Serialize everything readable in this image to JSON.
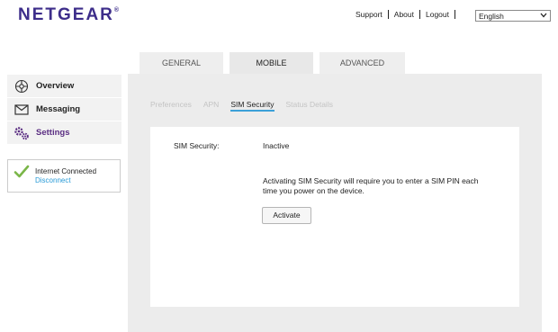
{
  "brand": {
    "name": "NETGEAR",
    "mark": "®"
  },
  "header": {
    "links": [
      "Support",
      "About",
      "Logout"
    ],
    "language": "English"
  },
  "tabs": [
    {
      "label": "GENERAL",
      "active": false
    },
    {
      "label": "MOBILE",
      "active": true
    },
    {
      "label": "ADVANCED",
      "active": false
    }
  ],
  "subtabs": [
    {
      "label": "Preferences",
      "active": false
    },
    {
      "label": "APN",
      "active": false
    },
    {
      "label": "SIM Security",
      "active": true
    },
    {
      "label": "Status Details",
      "active": false
    }
  ],
  "sidebar": {
    "items": [
      {
        "label": "Overview",
        "icon": "network-icon",
        "active": false
      },
      {
        "label": "Messaging",
        "icon": "envelope-icon",
        "active": false
      },
      {
        "label": "Settings",
        "icon": "gears-icon",
        "active": true
      }
    ]
  },
  "connection": {
    "status": "Internet Connected",
    "action": "Disconnect"
  },
  "sim_security": {
    "label": "SIM Security:",
    "value": "Inactive",
    "description": "Activating SIM Security will require you to enter a SIM PIN each time you power on the device.",
    "button": "Activate"
  },
  "colors": {
    "brand": "#3d2d8a",
    "accent": "#3ba0d8",
    "active_nav": "#5a2d82",
    "check": "#7ab648"
  }
}
